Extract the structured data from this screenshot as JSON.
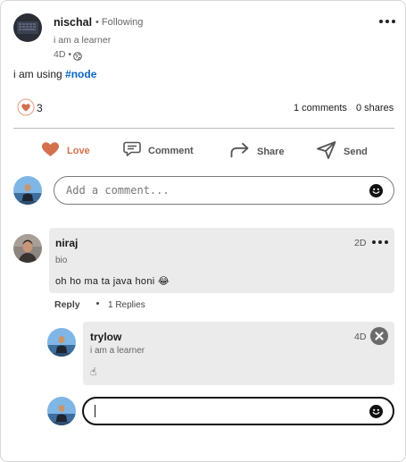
{
  "post": {
    "author": {
      "name": "nischal",
      "follow_status": "• Following",
      "bio": "i am a learner",
      "time": "4D •"
    },
    "text_prefix": "i am using ",
    "hashtag": "#node",
    "reactions_count": "3",
    "comments_label": "1 comments",
    "shares_label": "0 shares"
  },
  "actions": {
    "love": "Love",
    "comment": "Comment",
    "share": "Share",
    "send": "Send"
  },
  "comment_input": {
    "placeholder": "Add a comment..."
  },
  "comment": {
    "author": "niraj",
    "bio": "bio",
    "time": "2D",
    "text": "oh ho ma ta java honi 😂",
    "reply_label": "Reply",
    "replies_label": "1 Replies"
  },
  "reply": {
    "author": "trylow",
    "bio": "i am a learner",
    "time": "4D",
    "text": "☝"
  },
  "reply_input": {
    "value": ""
  },
  "colors": {
    "love": "#d4704e",
    "hashtag": "#0a66c2",
    "bubble": "#ebebeb"
  }
}
